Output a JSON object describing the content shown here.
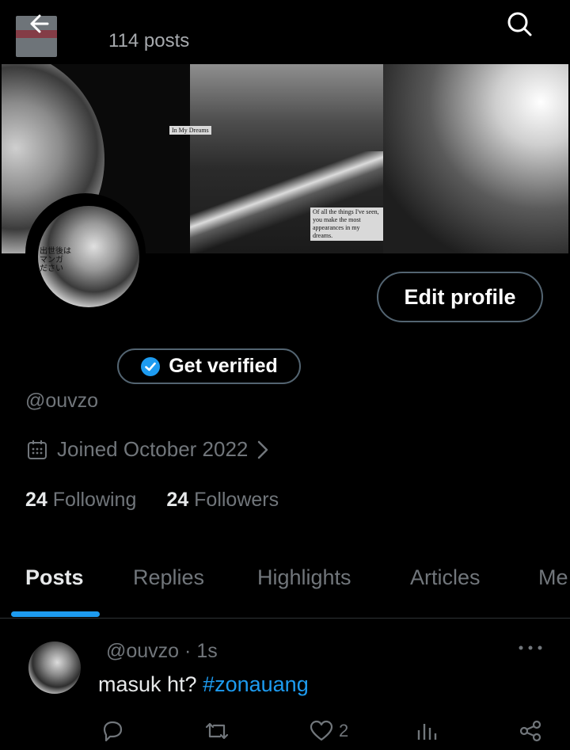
{
  "header": {
    "posts_count": "114 posts",
    "back_icon": "arrow-left-icon",
    "search_icon": "search-icon"
  },
  "banner": {
    "caption1": "In My Dreams",
    "caption2_line1": "Of all the things I've seen,",
    "caption2_line2": "you make the most appearances in my dreams."
  },
  "profile": {
    "edit_label": "Edit profile",
    "verify_label": "Get verified",
    "handle": "@ouvzo",
    "joined": "Joined October 2022",
    "following_count": "24",
    "following_label": "Following",
    "followers_count": "24",
    "followers_label": "Followers",
    "avatar_text1": "出世後は",
    "avatar_text2": "マンガ",
    "avatar_text3": "ださい"
  },
  "tabs": [
    "Posts",
    "Replies",
    "Highlights",
    "Articles",
    "Me"
  ],
  "post": {
    "handle": "@ouvzo",
    "time": "1s",
    "separator": "·",
    "text": "masuk ht?",
    "hashtag": "#zonauang",
    "likes": "2"
  },
  "colors": {
    "accent": "#1d9bf0",
    "muted": "#71767b",
    "border": "#536471"
  }
}
